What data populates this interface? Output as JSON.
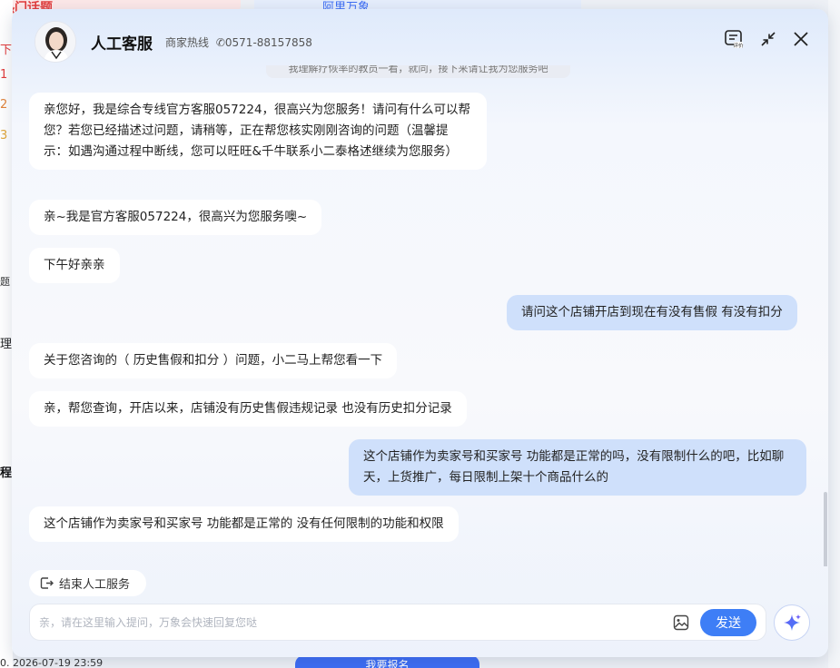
{
  "background": {
    "top_left_text": "热门话题",
    "top_mid_text": "阿里万象",
    "left_list": [
      "下",
      "1",
      "2",
      "3",
      "题",
      "理",
      "程"
    ],
    "bottom_date": "0. 2026-07-19 23:59",
    "bottom_button": "我要报名"
  },
  "header": {
    "title": "人工客服",
    "hotline_label": "商家热线",
    "hotline_number": "0571-88157858",
    "feedback_label": "评价"
  },
  "chat": {
    "notice": "我理解疗恢率的教员一看，就同，接下来请让我为您服务吧",
    "messages": [
      {
        "from": "agent",
        "text": "亲您好，我是综合专线官方客服057224，很高兴为您服务！请问有什么可以帮您？若您已经描述过问题，请稍等，正在帮您核实刚刚咨询的问题（温馨提示：如遇沟通过程中断线，您可以旺旺&千牛联系小二泰格述继续为您服务）"
      },
      {
        "from": "agent",
        "text": "亲~我是官方客服057224，很高兴为您服务噢~"
      },
      {
        "from": "agent",
        "text": "下午好亲亲"
      },
      {
        "from": "user",
        "text": "请问这个店铺开店到现在有没有售假 有没有扣分"
      },
      {
        "from": "agent",
        "text": "关于您咨询的（ 历史售假和扣分 ）问题，小二马上帮您看一下"
      },
      {
        "from": "agent",
        "text": "亲，帮您查询，开店以来，店铺没有历史售假违规记录 也没有历史扣分记录"
      },
      {
        "from": "user",
        "text": "这个店铺作为卖家号和买家号 功能都是正常的吗，没有限制什么的吧，比如聊天，上货推广，每日限制上架十个商品什么的"
      },
      {
        "from": "agent",
        "text": "这个店铺作为卖家号和买家号 功能都是正常的 没有任何限制的功能和权限"
      }
    ]
  },
  "footer": {
    "end_service_label": "结束人工服务",
    "input_placeholder": "亲，请在这里输入提问，万象会快速回复您哒",
    "input_value": "",
    "send_label": "发送"
  },
  "colors": {
    "accent": "#3e7ef6",
    "user_bubble": "#cfe0fb",
    "agent_bubble": "#ffffff"
  }
}
